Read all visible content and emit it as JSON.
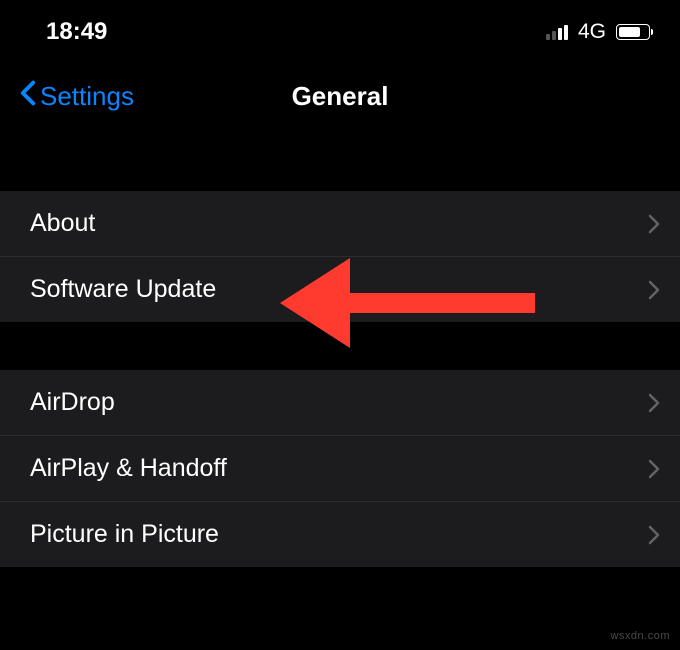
{
  "status_bar": {
    "time": "18:49",
    "network": "4G"
  },
  "nav": {
    "back_label": "Settings",
    "title": "General"
  },
  "group1": {
    "items": [
      {
        "label": "About"
      },
      {
        "label": "Software Update"
      }
    ]
  },
  "group2": {
    "items": [
      {
        "label": "AirDrop"
      },
      {
        "label": "AirPlay & Handoff"
      },
      {
        "label": "Picture in Picture"
      }
    ]
  },
  "watermark": "wsxdn.com",
  "colors": {
    "accent": "#0a84ff",
    "annotation": "#ff3b30"
  }
}
